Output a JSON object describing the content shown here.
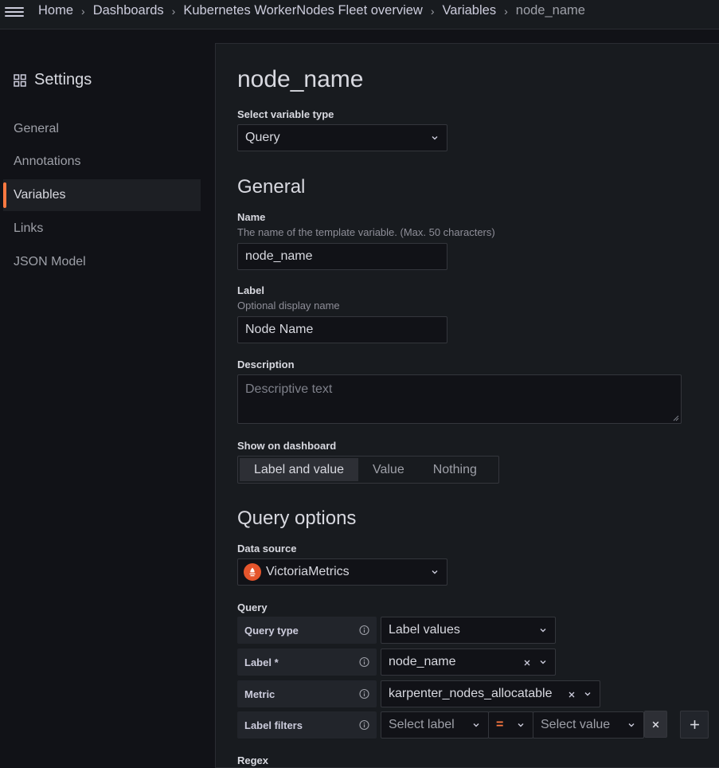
{
  "breadcrumb": [
    "Home",
    "Dashboards",
    "Kubernetes WorkerNodes Fleet overview",
    "Variables",
    "node_name"
  ],
  "sidebar": {
    "title": "Settings",
    "items": [
      {
        "label": "General"
      },
      {
        "label": "Annotations"
      },
      {
        "label": "Variables"
      },
      {
        "label": "Links"
      },
      {
        "label": "JSON Model"
      }
    ],
    "active_item": "Variables"
  },
  "main": {
    "title": "node_name",
    "variable_type": {
      "label": "Select variable type",
      "value": "Query"
    },
    "general": {
      "heading": "General",
      "name": {
        "label": "Name",
        "description": "The name of the template variable. (Max. 50 characters)",
        "value": "node_name"
      },
      "label_field": {
        "label": "Label",
        "description": "Optional display name",
        "value": "Node Name"
      },
      "description_field": {
        "label": "Description",
        "placeholder": "Descriptive text"
      },
      "show_on_dashboard": {
        "label": "Show on dashboard",
        "options": [
          "Label and value",
          "Value",
          "Nothing"
        ],
        "selected": "Label and value"
      }
    },
    "query_options": {
      "heading": "Query options",
      "data_source": {
        "label": "Data source",
        "value": "VictoriaMetrics"
      },
      "query_label": "Query",
      "query_type": {
        "label": "Query type",
        "value": "Label values"
      },
      "label_row": {
        "label": "Label *",
        "value": "node_name"
      },
      "metric": {
        "label": "Metric",
        "value": "karpenter_nodes_allocatable"
      },
      "label_filters": {
        "label": "Label filters",
        "label_placeholder": "Select label",
        "operator": "=",
        "value_placeholder": "Select value"
      },
      "regex_label": "Regex"
    }
  },
  "colors": {
    "accent": "#ff7941",
    "background": "#111217",
    "panel": "#181b1f",
    "datasource_icon": "#e5552c"
  }
}
